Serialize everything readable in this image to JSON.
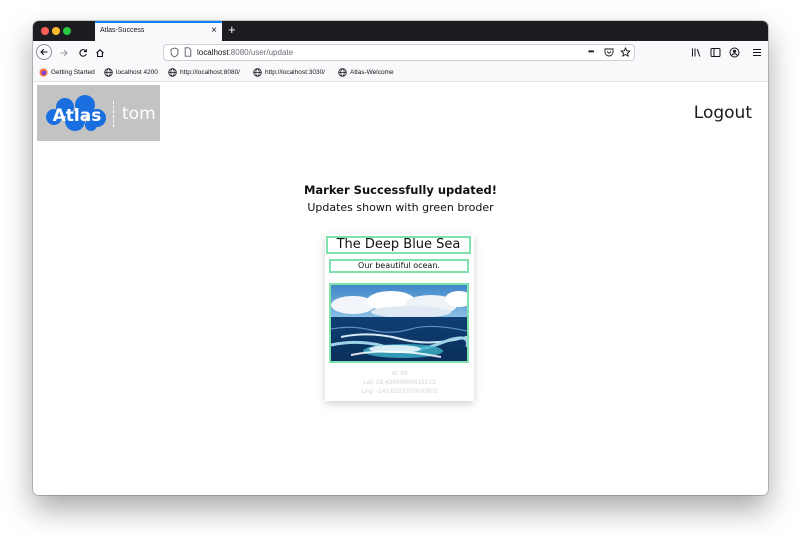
{
  "browser": {
    "tab_title": "Atlas-Success",
    "tab_close": "×",
    "new_tab": "+",
    "url_host": "localhost",
    "url_rest": ":8080/user/update",
    "url_more": "•••"
  },
  "bookmarks": [
    {
      "label": "Getting Started",
      "icon": "firefox-icon"
    },
    {
      "label": "localhost 4200",
      "icon": "globe-icon"
    },
    {
      "label": "http://localhost:8080/",
      "icon": "globe-icon"
    },
    {
      "label": "http://localhost:3030/",
      "icon": "globe-icon"
    },
    {
      "label": "Atlas-Welcome",
      "icon": "globe-icon"
    }
  ],
  "header": {
    "logo_text": "Atlas",
    "username": "tom",
    "logout_label": "Logout"
  },
  "message": {
    "title": "Marker Successfully updated!",
    "subtitle": "Updates shown with green broder"
  },
  "card": {
    "title": "The Deep Blue Sea",
    "description": "Our beautiful ocean.",
    "id_line": "id: 89",
    "lat_line": "Lat: 28.4368569961812З",
    "lng_line": "Lng: -143.6222700000001"
  },
  "colors": {
    "accent": "#0a84ff",
    "highlight_border": "#7fe2ad",
    "logo_blue": "#1a6fe0",
    "header_box": "#c3c3c3"
  }
}
